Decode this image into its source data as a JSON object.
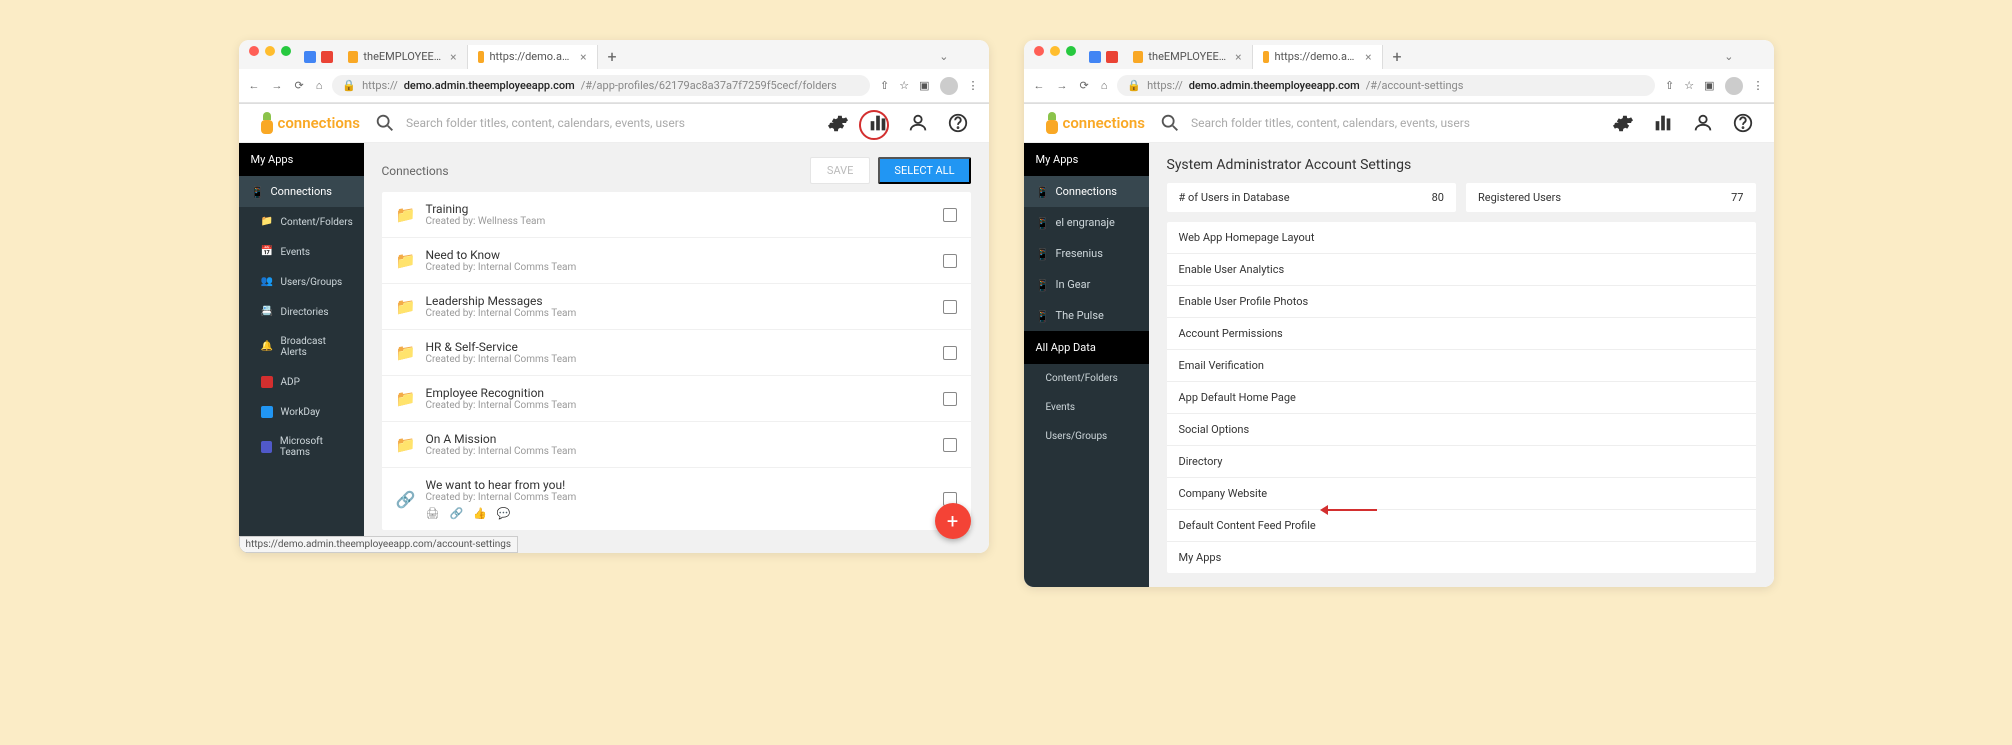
{
  "left": {
    "browser": {
      "pinned_icons": [
        "calendar",
        "gmail"
      ],
      "tabs": [
        {
          "label": "theEMPLOYEEapp",
          "active": false
        },
        {
          "label": "https://demo.admin.theemplo",
          "active": true
        }
      ],
      "url_prefix": "https://",
      "url_host": "demo.admin.theemployeeapp.com",
      "url_path": "/#/app-profiles/62179ac8a37a7f7259f5cecf/folders"
    },
    "app": {
      "logo_text": "connections",
      "search_placeholder": "Search folder titles, content, calendars, events, users"
    },
    "sidebar": {
      "header": "My Apps",
      "items": [
        {
          "label": "Connections",
          "icon": "phone",
          "active": true
        },
        {
          "label": "Content/Folders",
          "icon": "folder",
          "sub": true
        },
        {
          "label": "Events",
          "icon": "calendar",
          "sub": true
        },
        {
          "label": "Users/Groups",
          "icon": "users",
          "sub": true
        },
        {
          "label": "Directories",
          "icon": "directory",
          "sub": true
        },
        {
          "label": "Broadcast Alerts",
          "icon": "bell",
          "sub": true
        },
        {
          "label": "ADP",
          "icon": "adp",
          "sub": true
        },
        {
          "label": "WorkDay",
          "icon": "workday",
          "sub": true
        },
        {
          "label": "Microsoft Teams",
          "icon": "teams",
          "sub": true
        }
      ]
    },
    "content": {
      "section_label": "Connections",
      "save_label": "SAVE",
      "select_all_label": "SELECT ALL",
      "folders": [
        {
          "title": "Training",
          "subtitle": "Created by: Wellness Team",
          "icon": "folder"
        },
        {
          "title": "Need to Know",
          "subtitle": "Created by: Internal Comms Team",
          "icon": "folder"
        },
        {
          "title": "Leadership Messages",
          "subtitle": "Created by: Internal Comms Team",
          "icon": "folder"
        },
        {
          "title": "HR & Self-Service",
          "subtitle": "Created by: Internal Comms Team",
          "icon": "folder"
        },
        {
          "title": "Employee Recognition",
          "subtitle": "Created by: Internal Comms Team",
          "icon": "folder"
        },
        {
          "title": "On A Mission",
          "subtitle": "Created by: Internal Comms Team",
          "icon": "folder"
        },
        {
          "title": "We want to hear from you!",
          "subtitle": "Created by: Internal Comms Team",
          "icon": "link",
          "extras": true
        }
      ]
    },
    "tooltip": "https://demo.admin.theemployeeapp.com/account-settings"
  },
  "right": {
    "browser": {
      "pinned_icons": [
        "calendar",
        "gmail"
      ],
      "tabs": [
        {
          "label": "theEMPLOYEEapp",
          "active": false
        },
        {
          "label": "https://demo.admin.theemplo",
          "active": true
        }
      ],
      "url_prefix": "https://",
      "url_host": "demo.admin.theemployeeapp.com",
      "url_path": "/#/account-settings"
    },
    "app": {
      "logo_text": "connections",
      "search_placeholder": "Search folder titles, content, calendars, events, users"
    },
    "sidebar": {
      "header": "My Apps",
      "items": [
        {
          "label": "Connections",
          "icon": "phone",
          "active": true
        },
        {
          "label": "el engranaje",
          "icon": "phone"
        },
        {
          "label": "Fresenius",
          "icon": "phone"
        },
        {
          "label": "In Gear",
          "icon": "phone"
        },
        {
          "label": "The Pulse",
          "icon": "phone"
        }
      ],
      "all_data_header": "All App Data",
      "all_items": [
        {
          "label": "Content/Folders"
        },
        {
          "label": "Events"
        },
        {
          "label": "Users/Groups"
        }
      ]
    },
    "content": {
      "page_title": "System Administrator Account Settings",
      "stats": [
        {
          "label": "# of Users in Database",
          "value": "80"
        },
        {
          "label": "Registered Users",
          "value": "77"
        }
      ],
      "settings": [
        "Web App Homepage Layout",
        "Enable User Analytics",
        "Enable User Profile Photos",
        "Account Permissions",
        "Email Verification",
        "App Default Home Page",
        "Social Options",
        "Directory",
        "Company Website",
        "Default Content Feed Profile",
        "My Apps"
      ]
    }
  }
}
